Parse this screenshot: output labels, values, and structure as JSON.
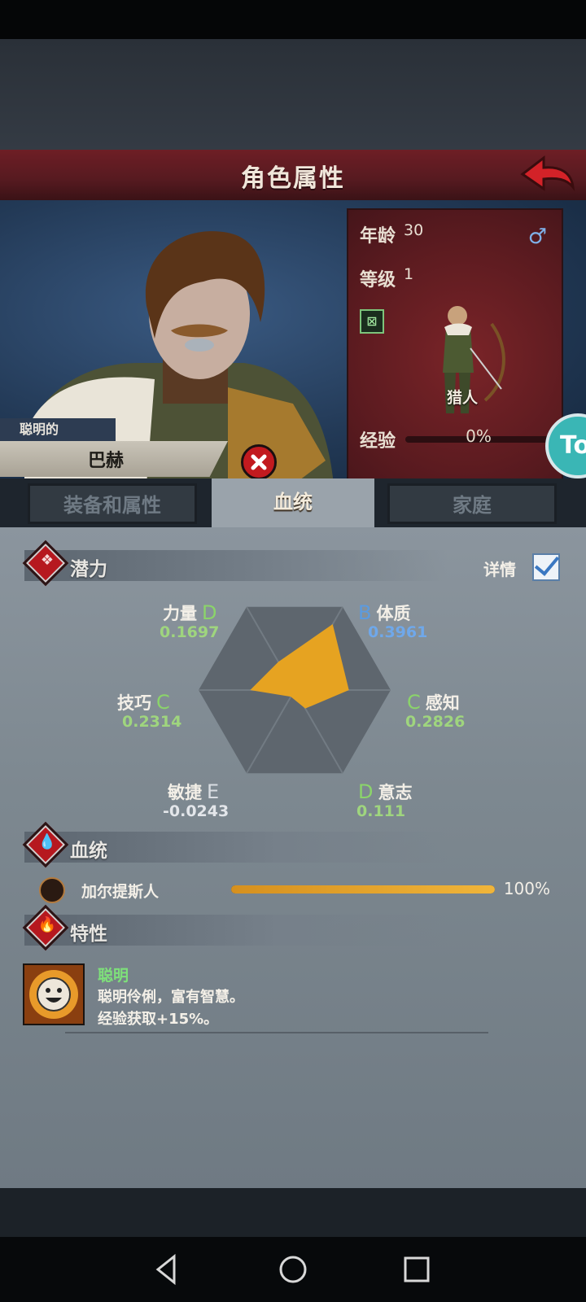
{
  "header": {
    "title": "角色属性"
  },
  "character": {
    "epithet": "聪明的",
    "name": "巴赫",
    "age_label": "年龄",
    "age": "30",
    "level_label": "等级",
    "level": "1",
    "class_name": "猎人",
    "exp_label": "经验",
    "exp_pct": "0%",
    "gender_symbol": "♂",
    "side_badge": "To"
  },
  "tabs": [
    {
      "label": "装备和属性",
      "active": false
    },
    {
      "label": "血统",
      "active": true
    },
    {
      "label": "家庭",
      "active": false
    }
  ],
  "potential": {
    "title": "潜力",
    "details_label": "详情",
    "details_checked": true,
    "attributes": [
      {
        "name": "力量",
        "grade": "D",
        "value": "0.1697",
        "score": 0.1697
      },
      {
        "name": "体质",
        "grade": "B",
        "value": "0.3961",
        "score": 0.3961
      },
      {
        "name": "感知",
        "grade": "C",
        "value": "0.2826",
        "score": 0.2826
      },
      {
        "name": "意志",
        "grade": "D",
        "value": "0.111",
        "score": 0.111
      },
      {
        "name": "敏捷",
        "grade": "E",
        "value": "-0.0243",
        "score": -0.0243
      },
      {
        "name": "技巧",
        "grade": "C",
        "value": "0.2314",
        "score": 0.2314
      }
    ]
  },
  "lineage": {
    "title": "血统",
    "items": [
      {
        "name": "加尔提斯人",
        "pct_label": "100%",
        "fraction": 1.0
      }
    ]
  },
  "traits": {
    "title": "特性",
    "items": [
      {
        "name": "聪明",
        "desc_line1": "聪明伶俐，富有智慧。",
        "desc_line2": "经验获取+15%。"
      }
    ]
  },
  "colors": {
    "grade_B": "#5b9be0",
    "grade_C": "#8bd46a",
    "grade_D": "#8bd46a",
    "grade_E": "#d9dde2",
    "radar_fill": "#e6a321"
  },
  "icons": {
    "back": "back-arrow-icon",
    "close": "close-icon",
    "gender": "male-icon",
    "class": "class-icon",
    "potential": "potential-icon",
    "lineage": "blood-drop-icon",
    "traits": "flame-icon",
    "lineage_item": "lineage-emblem-icon",
    "trait_item": "smile-face-icon"
  }
}
